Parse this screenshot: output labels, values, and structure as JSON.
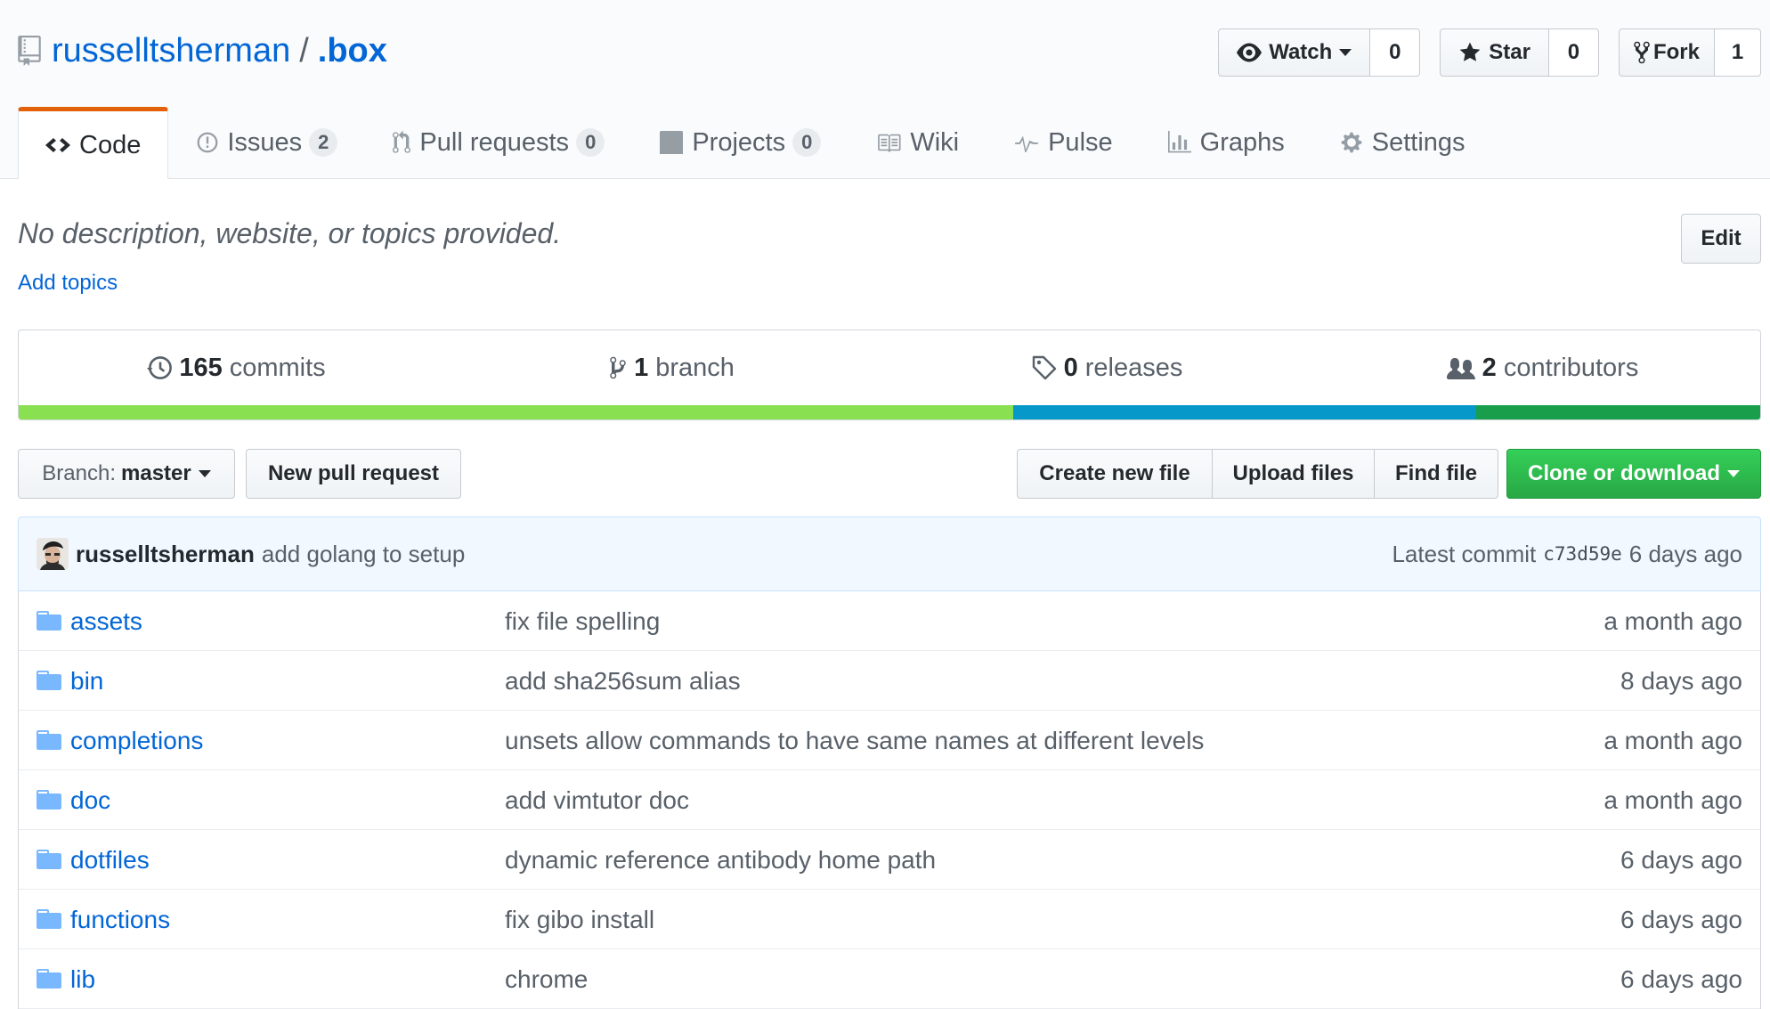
{
  "repo": {
    "owner": "russelltsherman",
    "separator": "/",
    "name": ".box"
  },
  "actions": {
    "watch": {
      "label": "Watch",
      "count": "0"
    },
    "star": {
      "label": "Star",
      "count": "0"
    },
    "fork": {
      "label": "Fork",
      "count": "1"
    }
  },
  "nav": {
    "tabs": [
      {
        "label": "Code",
        "icon": "code-icon"
      },
      {
        "label": "Issues",
        "count": "2",
        "icon": "issue-icon"
      },
      {
        "label": "Pull requests",
        "count": "0",
        "icon": "pull-request-icon"
      },
      {
        "label": "Projects",
        "count": "0",
        "icon": "project-icon"
      },
      {
        "label": "Wiki",
        "icon": "book-icon"
      },
      {
        "label": "Pulse",
        "icon": "pulse-icon"
      },
      {
        "label": "Graphs",
        "icon": "graph-icon"
      },
      {
        "label": "Settings",
        "icon": "gear-icon"
      }
    ]
  },
  "description": {
    "text": "No description, website, or topics provided.",
    "add_topics": "Add topics",
    "edit_label": "Edit"
  },
  "summary": {
    "commits": {
      "num": "165",
      "label": "commits"
    },
    "branches": {
      "num": "1",
      "label": "branch"
    },
    "releases": {
      "num": "0",
      "label": "releases"
    },
    "contributors": {
      "num": "2",
      "label": "contributors"
    }
  },
  "languages": [
    {
      "color": "#89e051",
      "share": 0.571
    },
    {
      "color": "#0598c9",
      "share": 0.266
    },
    {
      "color": "#199f4b",
      "share": 0.163
    }
  ],
  "file_nav": {
    "branch_prefix": "Branch:",
    "branch_name": "master",
    "new_pull_request": "New pull request",
    "create_new_file": "Create new file",
    "upload_files": "Upload files",
    "find_file": "Find file",
    "clone_or_download": "Clone or download"
  },
  "latest_commit": {
    "author": "russelltsherman",
    "message": "add golang to setup",
    "prefix": "Latest commit",
    "sha": "c73d59e",
    "age": "6 days ago"
  },
  "files": [
    {
      "name": "assets",
      "message": "fix file spelling",
      "age": "a month ago"
    },
    {
      "name": "bin",
      "message": "add sha256sum alias",
      "age": "8 days ago"
    },
    {
      "name": "completions",
      "message": "unsets allow commands to have same names at different levels",
      "age": "a month ago"
    },
    {
      "name": "doc",
      "message": "add vimtutor doc",
      "age": "a month ago"
    },
    {
      "name": "dotfiles",
      "message": "dynamic reference antibody home path",
      "age": "6 days ago"
    },
    {
      "name": "functions",
      "message": "fix gibo install",
      "age": "6 days ago"
    },
    {
      "name": "lib",
      "message": "chrome",
      "age": "6 days ago"
    }
  ]
}
